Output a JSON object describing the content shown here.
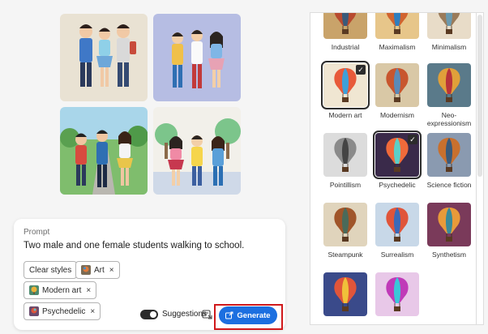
{
  "prompt": {
    "label": "Prompt",
    "text": "Two male and one female students walking to school.",
    "chips": {
      "clear": "Clear styles",
      "art": "Art",
      "modern": "Modern art",
      "psychedelic": "Psychedelic",
      "remove": "×"
    },
    "suggestions_label": "Suggestions",
    "generate_label": "Generate"
  },
  "styles": [
    {
      "label": "Industrial",
      "selected": false
    },
    {
      "label": "Maximalism",
      "selected": false
    },
    {
      "label": "Minimalism",
      "selected": false
    },
    {
      "label": "Modern art",
      "selected": true
    },
    {
      "label": "Modernism",
      "selected": false
    },
    {
      "label": "Neo-expressionism",
      "selected": false
    },
    {
      "label": "Pointillism",
      "selected": false
    },
    {
      "label": "Psychedelic",
      "selected": true
    },
    {
      "label": "Science fiction",
      "selected": false
    },
    {
      "label": "Steampunk",
      "selected": false
    },
    {
      "label": "Surrealism",
      "selected": false
    },
    {
      "label": "Synthetism",
      "selected": false
    },
    {
      "label": "",
      "selected": false
    },
    {
      "label": "",
      "selected": false
    }
  ],
  "check_glyph": "✓",
  "colors": {
    "accent": "#1c6fe0",
    "highlight": "#d0191b"
  }
}
